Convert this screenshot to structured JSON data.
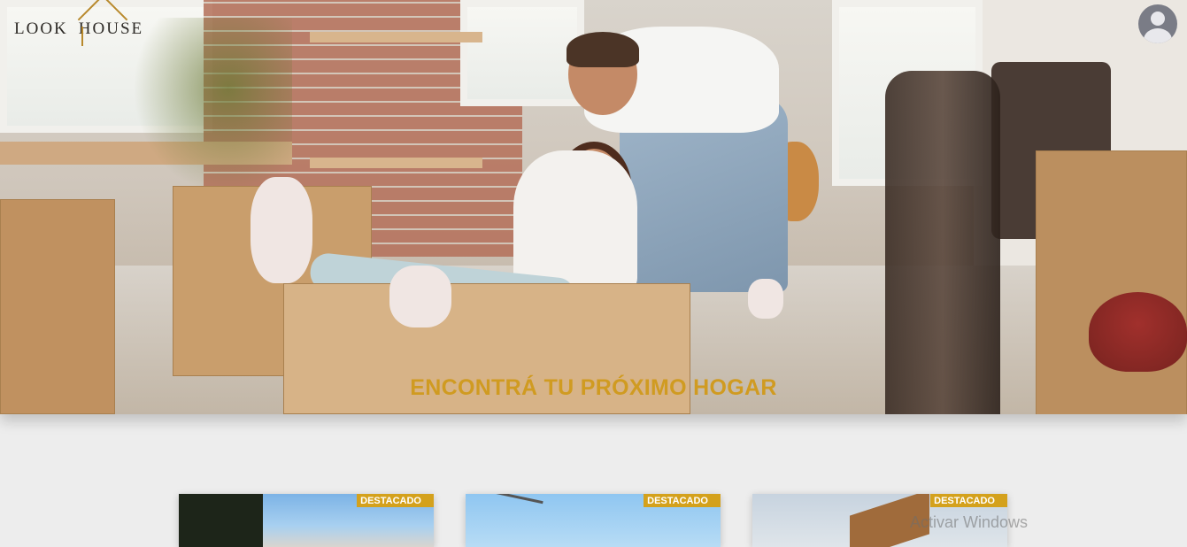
{
  "header": {
    "logo_text_left": "LOOK",
    "logo_text_right": "HOUSE",
    "user_icon": "user-circle-icon"
  },
  "hero": {
    "title": "ENCONTRÁ TU PRÓXIMO HOGAR"
  },
  "cards": [
    {
      "badge": "DESTACADO"
    },
    {
      "badge": "DESTACADO"
    },
    {
      "badge": "DESTACADO"
    }
  ],
  "overlay": {
    "windows_watermark": "Activar Windows"
  },
  "colors": {
    "accent": "#d09b21",
    "badge": "#d4a11c",
    "background": "#ededed"
  }
}
